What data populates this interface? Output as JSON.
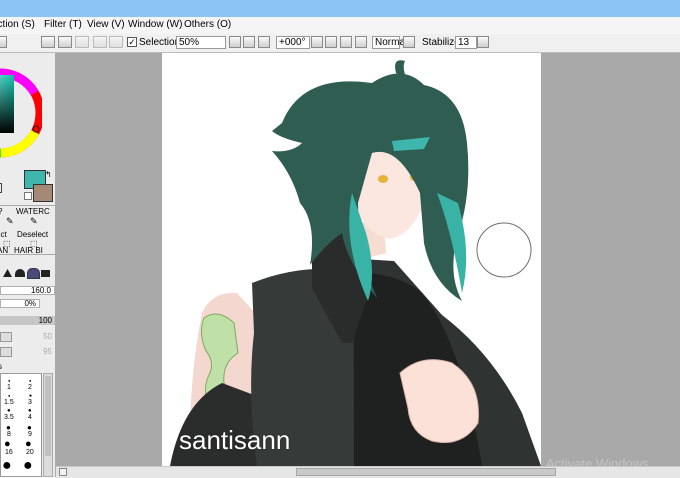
{
  "menu": [
    "ection (S)",
    "Filter (T)",
    "View (V)",
    "Window (W)",
    "Others (O)"
  ],
  "toolbar": {
    "selection_label": "Selection",
    "selection_checked": true,
    "zoom": "50%",
    "rotation": "+000°",
    "blend": "Normal",
    "stabilizer_label": "Stabilizer",
    "stabilizer": "13"
  },
  "colors": {
    "primary": "#3fb6ad",
    "secondary": "#a68975",
    "canvas_bg": "#a9a9a9",
    "titlebar": "#8cc4f5"
  },
  "tools": {
    "row1": [
      "?",
      "WATERC"
    ],
    "row2": [
      "ect",
      "Deselect"
    ],
    "row3": [
      "AN",
      "HAIR BI"
    ]
  },
  "brush": {
    "size": "160.0",
    "density": "0%",
    "value": "100",
    "min_width": "50",
    "min_density": "95"
  },
  "brush_sizes": [
    [
      "1",
      "2"
    ],
    [
      "1.5",
      "3"
    ],
    [
      "3.5",
      "4"
    ],
    [
      "8",
      "9"
    ],
    [
      "16",
      "20"
    ]
  ],
  "brush_sizes_header": "s",
  "canvas": {
    "watermark": "santisann",
    "os_watermark": "Activate Windows"
  }
}
